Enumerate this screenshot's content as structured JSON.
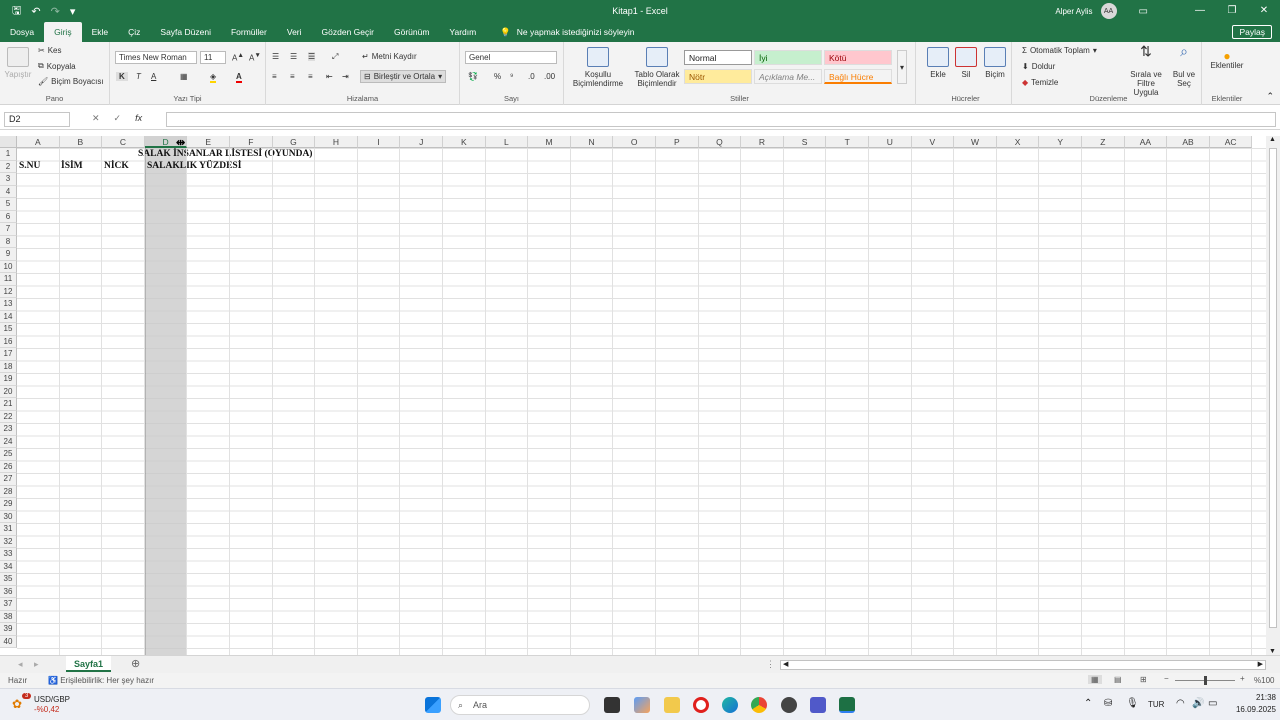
{
  "titlebar": {
    "title": "Kitap1 - Excel",
    "user": "Alper Aylis",
    "avatar": "AA"
  },
  "menu": {
    "tabs": [
      "Dosya",
      "Giriş",
      "Ekle",
      "Çiz",
      "Sayfa Düzeni",
      "Formüller",
      "Veri",
      "Gözden Geçir",
      "Görünüm",
      "Yardım"
    ],
    "active_index": 1,
    "tell_me": "Ne yapmak istediğinizi söyleyin",
    "share": "Paylaş"
  },
  "ribbon": {
    "clipboard": {
      "paste": "Yapıştır",
      "cut": "Kes",
      "copy": "Kopyala",
      "format_painter": "Biçim Boyacısı",
      "label": "Pano"
    },
    "font": {
      "name": "Times New Roman",
      "size": "11",
      "bold": "K",
      "italic": "T",
      "underline": "A",
      "label": "Yazı Tipi"
    },
    "alignment": {
      "wrap": "Metni Kaydır",
      "merge": "Birleştir ve Ortala",
      "label": "Hizalama"
    },
    "number": {
      "format": "Genel",
      "label": "Sayı"
    },
    "styles": {
      "conditional": "Koşullu Biçimlendirme",
      "table": "Tablo Olarak Biçimlendir",
      "cells": [
        "Normal",
        "İyi",
        "Kötü",
        "Nötr",
        "Açıklama Me...",
        "Bağlı Hücre"
      ],
      "label": "Stiller"
    },
    "cells": {
      "insert": "Ekle",
      "delete": "Sil",
      "format": "Biçim",
      "label": "Hücreler"
    },
    "editing": {
      "autosum": "Otomatik Toplam",
      "fill": "Doldur",
      "clear": "Temizle",
      "sort": "Sırala ve Filtre Uygula",
      "find": "Bul ve Seç",
      "label": "Düzenleme"
    },
    "addins": {
      "label_btn": "Eklentiler",
      "label": "Eklentiler"
    }
  },
  "formula": {
    "namebox": "D2",
    "fx": "fx",
    "content": ""
  },
  "grid": {
    "columns": [
      "A",
      "B",
      "C",
      "D",
      "E",
      "F",
      "G",
      "H",
      "I",
      "J",
      "K",
      "L",
      "M",
      "N",
      "O",
      "P",
      "Q",
      "R",
      "S",
      "T",
      "U",
      "V",
      "W",
      "X",
      "Y",
      "Z",
      "AA",
      "AB",
      "AC"
    ],
    "selected_column": "D",
    "rows": [
      "1",
      "2",
      "3",
      "4",
      "5",
      "6",
      "7",
      "8",
      "9",
      "10",
      "11",
      "12",
      "13",
      "14",
      "15",
      "16",
      "17",
      "18",
      "19",
      "20",
      "21",
      "22",
      "23",
      "24",
      "25",
      "26",
      "27",
      "28",
      "29",
      "30",
      "31",
      "32",
      "33",
      "34",
      "35",
      "36",
      "37",
      "38",
      "39",
      "40"
    ],
    "cells": {
      "title": "SALAK İNSANLAR LİSTESİ (OYUNDA)",
      "a2": "S.NU",
      "b2": "İSİM",
      "c2": "NİCK",
      "d2": "SALAKLIK YÜZDESİ"
    }
  },
  "sheets": {
    "tab": "Sayfa1"
  },
  "status": {
    "ready": "Hazır",
    "accessibility": "Erişilebilirlik: Her şey hazır",
    "zoom": "%100"
  },
  "taskbar": {
    "widget_title": "USD/GBP",
    "widget_value": "-%0,42",
    "badge": "3",
    "search": "Ara",
    "lang": "TUR",
    "time": "21:38",
    "date": "16.09.2025"
  }
}
